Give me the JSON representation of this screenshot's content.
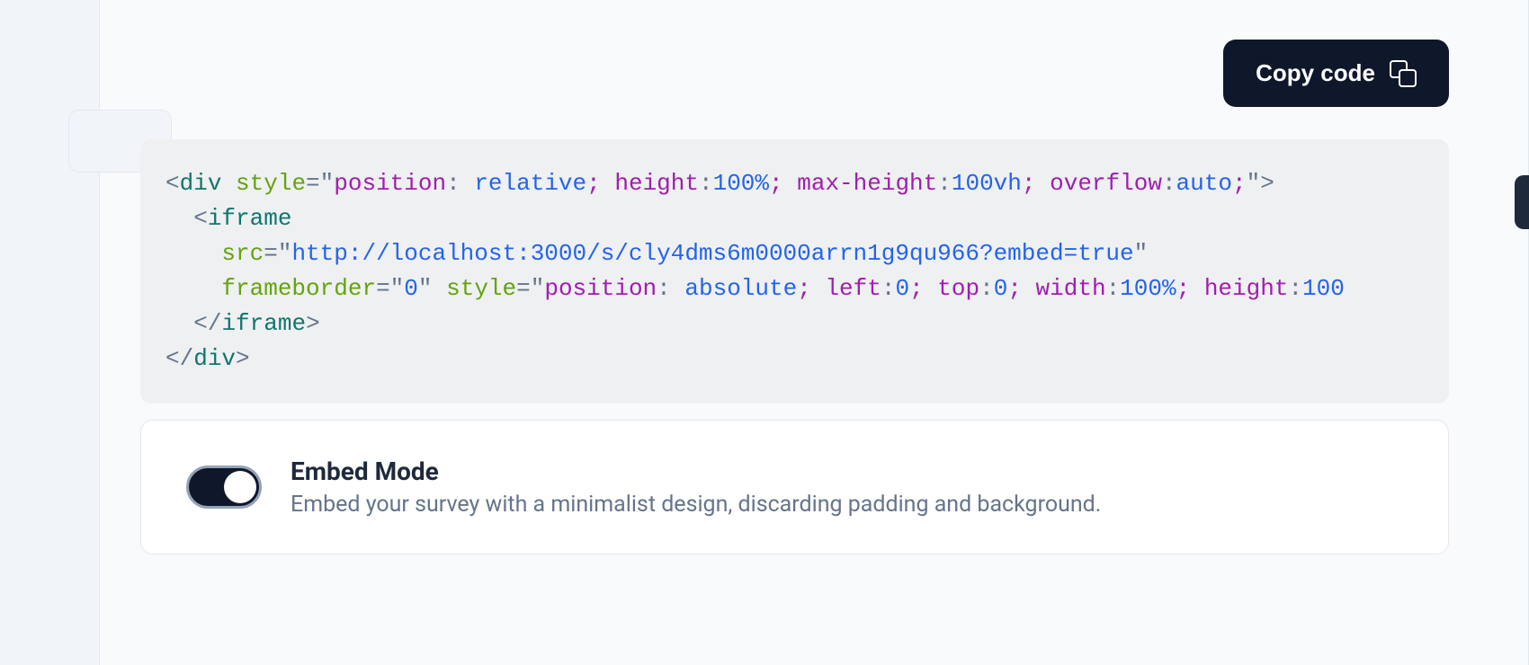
{
  "copy_button": {
    "label": "Copy code"
  },
  "code": {
    "outer_tag": "div",
    "outer_style_props": [
      {
        "prop": "position",
        "val": "relative"
      },
      {
        "prop": "height",
        "val": "100%"
      },
      {
        "prop": "max-height",
        "val": "100vh"
      },
      {
        "prop": "overflow",
        "val": "auto"
      }
    ],
    "iframe_tag": "iframe",
    "iframe_src_attr": "src",
    "iframe_src_val": "http://localhost:3000/s/cly4dms6m0000arrn1g9qu966?embed=true",
    "iframe_frameborder_attr": "frameborder",
    "iframe_frameborder_val": "0",
    "iframe_style_props": [
      {
        "prop": "position",
        "val": "absolute"
      },
      {
        "prop": "left",
        "val": "0"
      },
      {
        "prop": "top",
        "val": "0"
      },
      {
        "prop": "width",
        "val": "100%"
      },
      {
        "prop": "height",
        "val": "100"
      }
    ]
  },
  "embed_mode": {
    "title": "Embed Mode",
    "desc": "Embed your survey with a minimalist design, discarding padding and background.",
    "enabled": true
  }
}
